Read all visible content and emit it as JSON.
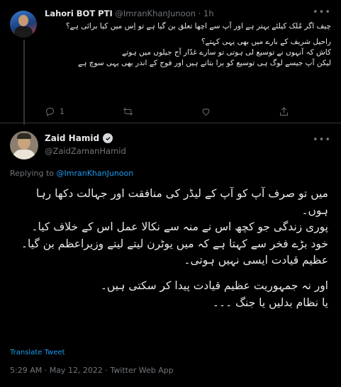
{
  "tweet1": {
    "display_name": "Lahori BOT PTI",
    "handle": "@ImranKhanJunoon",
    "separator": "·",
    "time": "1h",
    "body": [
      "چیف اگر مُلک کیلئے بہتر ہے اور آپ سے اچھا تعلق بن گیا ہے تو اِس میں کیا برائی ہے؟",
      "راحیل شریف کے بارے میں بھی یہی کہتے؟\nکاش کہ آنہوں نے توسیع لی ہوتی تو سارے غدّار آج جیلوں میں ہوتے\nلیکن آپ جیسے لوگ ہی توسیع کو برا بتاتے ہیں اور فوج کے اندر بھی یہی سوچ ہے"
    ],
    "reply_count": "1"
  },
  "tweet2": {
    "display_name": "Zaid Hamid",
    "handle": "@ZaidZamanHamid",
    "replying_to_label": "Replying to",
    "replying_to_handle": "@ImranKhanJunoon",
    "body_lines": [
      "میں تو صرف آپ کو آپ کے لیڈر کی منافقت اور جہالت دکھا رہا ہوں۔",
      "پوری زندگی جو کچھ اس نے منہ سے نکالا عمل اس کے خلاف کیا۔",
      "خود بڑے فخر سے کہتا ہے کہ میں یوٹرن لیتے لیتے وزیراعظم بن گیا۔",
      "عظیم قیادت ایسی نہیں ہوتی۔"
    ],
    "body_lines_2": [
      "اور نہ جمہوریت عظیم قیادت پیدا کر سکتی ہیں۔",
      "یا نظام بدلیں یا جنگ ۔۔۔"
    ],
    "translate_label": "Translate Tweet",
    "timestamp": "5:29 AM · May 12, 2022 · Twitter Web App"
  },
  "colors": {
    "background": "#000000",
    "text": "#e7e9ea",
    "muted": "#71767b",
    "accent": "#1d9bf0"
  },
  "icons": [
    "reply-icon",
    "retweet-icon",
    "like-icon",
    "share-icon",
    "verified-badge-icon",
    "more-options-icon"
  ]
}
